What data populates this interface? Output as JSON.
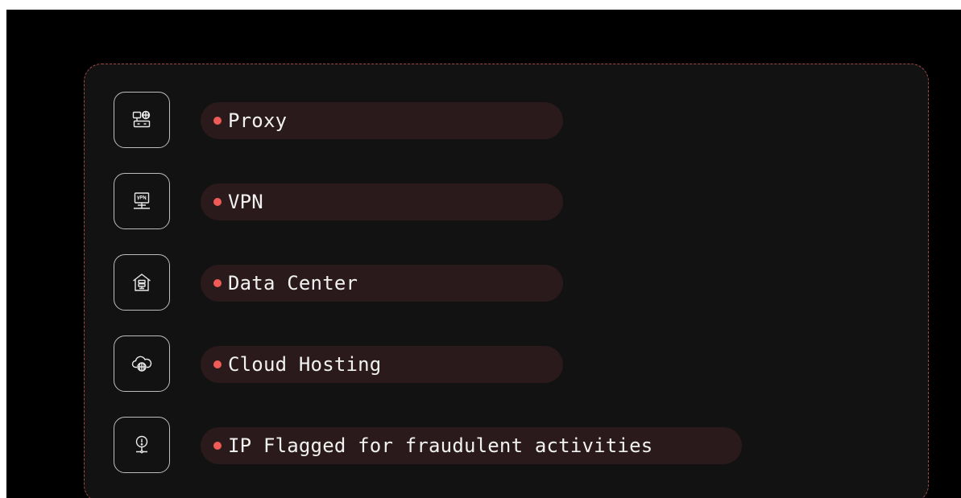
{
  "theme": {
    "accent": "#f05a57",
    "card_background": "#121212",
    "pill_background": "#2a1a1c",
    "border_dash": "#9e4a48"
  },
  "items": [
    {
      "label": "Proxy",
      "icon": "proxy-network-icon"
    },
    {
      "label": "VPN",
      "icon": "vpn-monitor-icon"
    },
    {
      "label": "Data Center",
      "icon": "data-center-icon"
    },
    {
      "label": "Cloud Hosting",
      "icon": "cloud-globe-icon"
    },
    {
      "label": "IP Flagged for fraudulent activities",
      "icon": "alert-pin-icon"
    }
  ]
}
